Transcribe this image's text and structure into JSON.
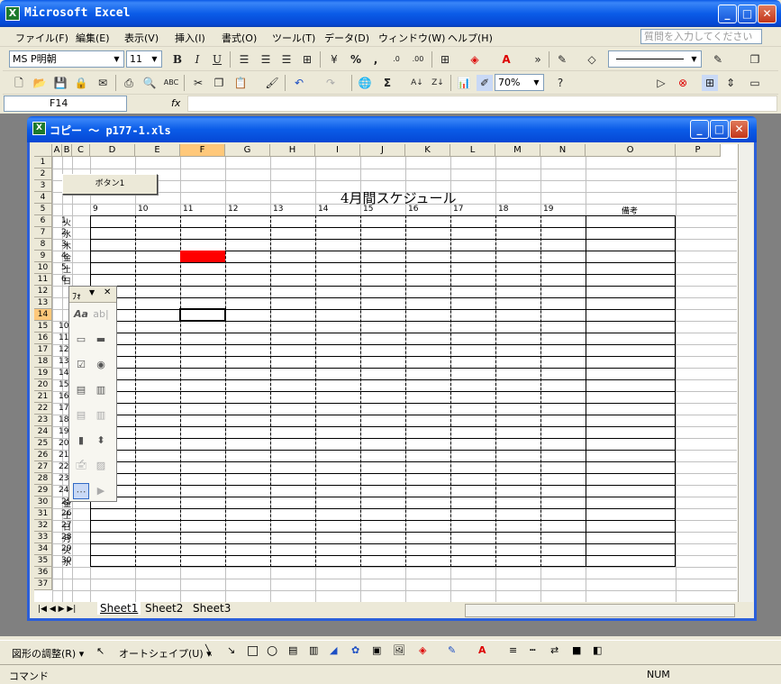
{
  "app": {
    "title": "Microsoft Excel",
    "icon": "excel-icon"
  },
  "menu": {
    "items": [
      "ファイル(F)",
      "編集(E)",
      "表示(V)",
      "挿入(I)",
      "書式(O)",
      "ツール(T)",
      "データ(D)",
      "ウィンドウ(W)",
      "ヘルプ(H)"
    ],
    "help_placeholder": "質問を入力してください"
  },
  "format_toolbar": {
    "font": "MS P明朝",
    "size": "11",
    "bold": "B",
    "italic": "I",
    "underline": "U",
    "percent": "%",
    "comma": ","
  },
  "standard_toolbar": {
    "sum": "Σ",
    "zoom": "70%"
  },
  "formula_bar": {
    "name_box": "F14",
    "fx": "fx",
    "formula": ""
  },
  "workbook": {
    "title": "コピー ～ p177-1.xls",
    "sheet": {
      "columns": [
        "A",
        "B",
        "C",
        "D",
        "E",
        "F",
        "G",
        "H",
        "I",
        "J",
        "K",
        "L",
        "M",
        "N",
        "O",
        "P"
      ],
      "active_column": "F",
      "active_row": "14",
      "button_label": "ボタン1",
      "schedule_title": "4月間スケジュール",
      "hour_labels": [
        "9",
        "10",
        "11",
        "12",
        "13",
        "14",
        "15",
        "16",
        "17",
        "18",
        "19"
      ],
      "remarks_label": "備考",
      "days": [
        [
          "1",
          "火"
        ],
        [
          "2",
          "水"
        ],
        [
          "3",
          "木"
        ],
        [
          "4",
          "金"
        ],
        [
          "5",
          "土"
        ],
        [
          "6",
          "日"
        ],
        [
          "25",
          "金"
        ],
        [
          "26",
          "土"
        ],
        [
          "27",
          "日"
        ],
        [
          "28",
          "月"
        ],
        [
          "29",
          "火"
        ],
        [
          "30",
          "水"
        ]
      ],
      "visible_day_numbers": [
        "10",
        "11",
        "12",
        "13",
        "14",
        "15",
        "16",
        "17",
        "18",
        "19",
        "20",
        "21",
        "22",
        "23",
        "24"
      ],
      "highlight_color": "#ff0000"
    },
    "forms_palette": {
      "title": "ﾌｫ"
    },
    "tabs": [
      "Sheet1",
      "Sheet2",
      "Sheet3"
    ]
  },
  "drawing_toolbar": {
    "draw_menu": "図形の調整(R) ▾",
    "autoshape_menu": "オートシェイプ(U) ▾"
  },
  "status": {
    "mode": "コマンド",
    "num": "NUM"
  }
}
